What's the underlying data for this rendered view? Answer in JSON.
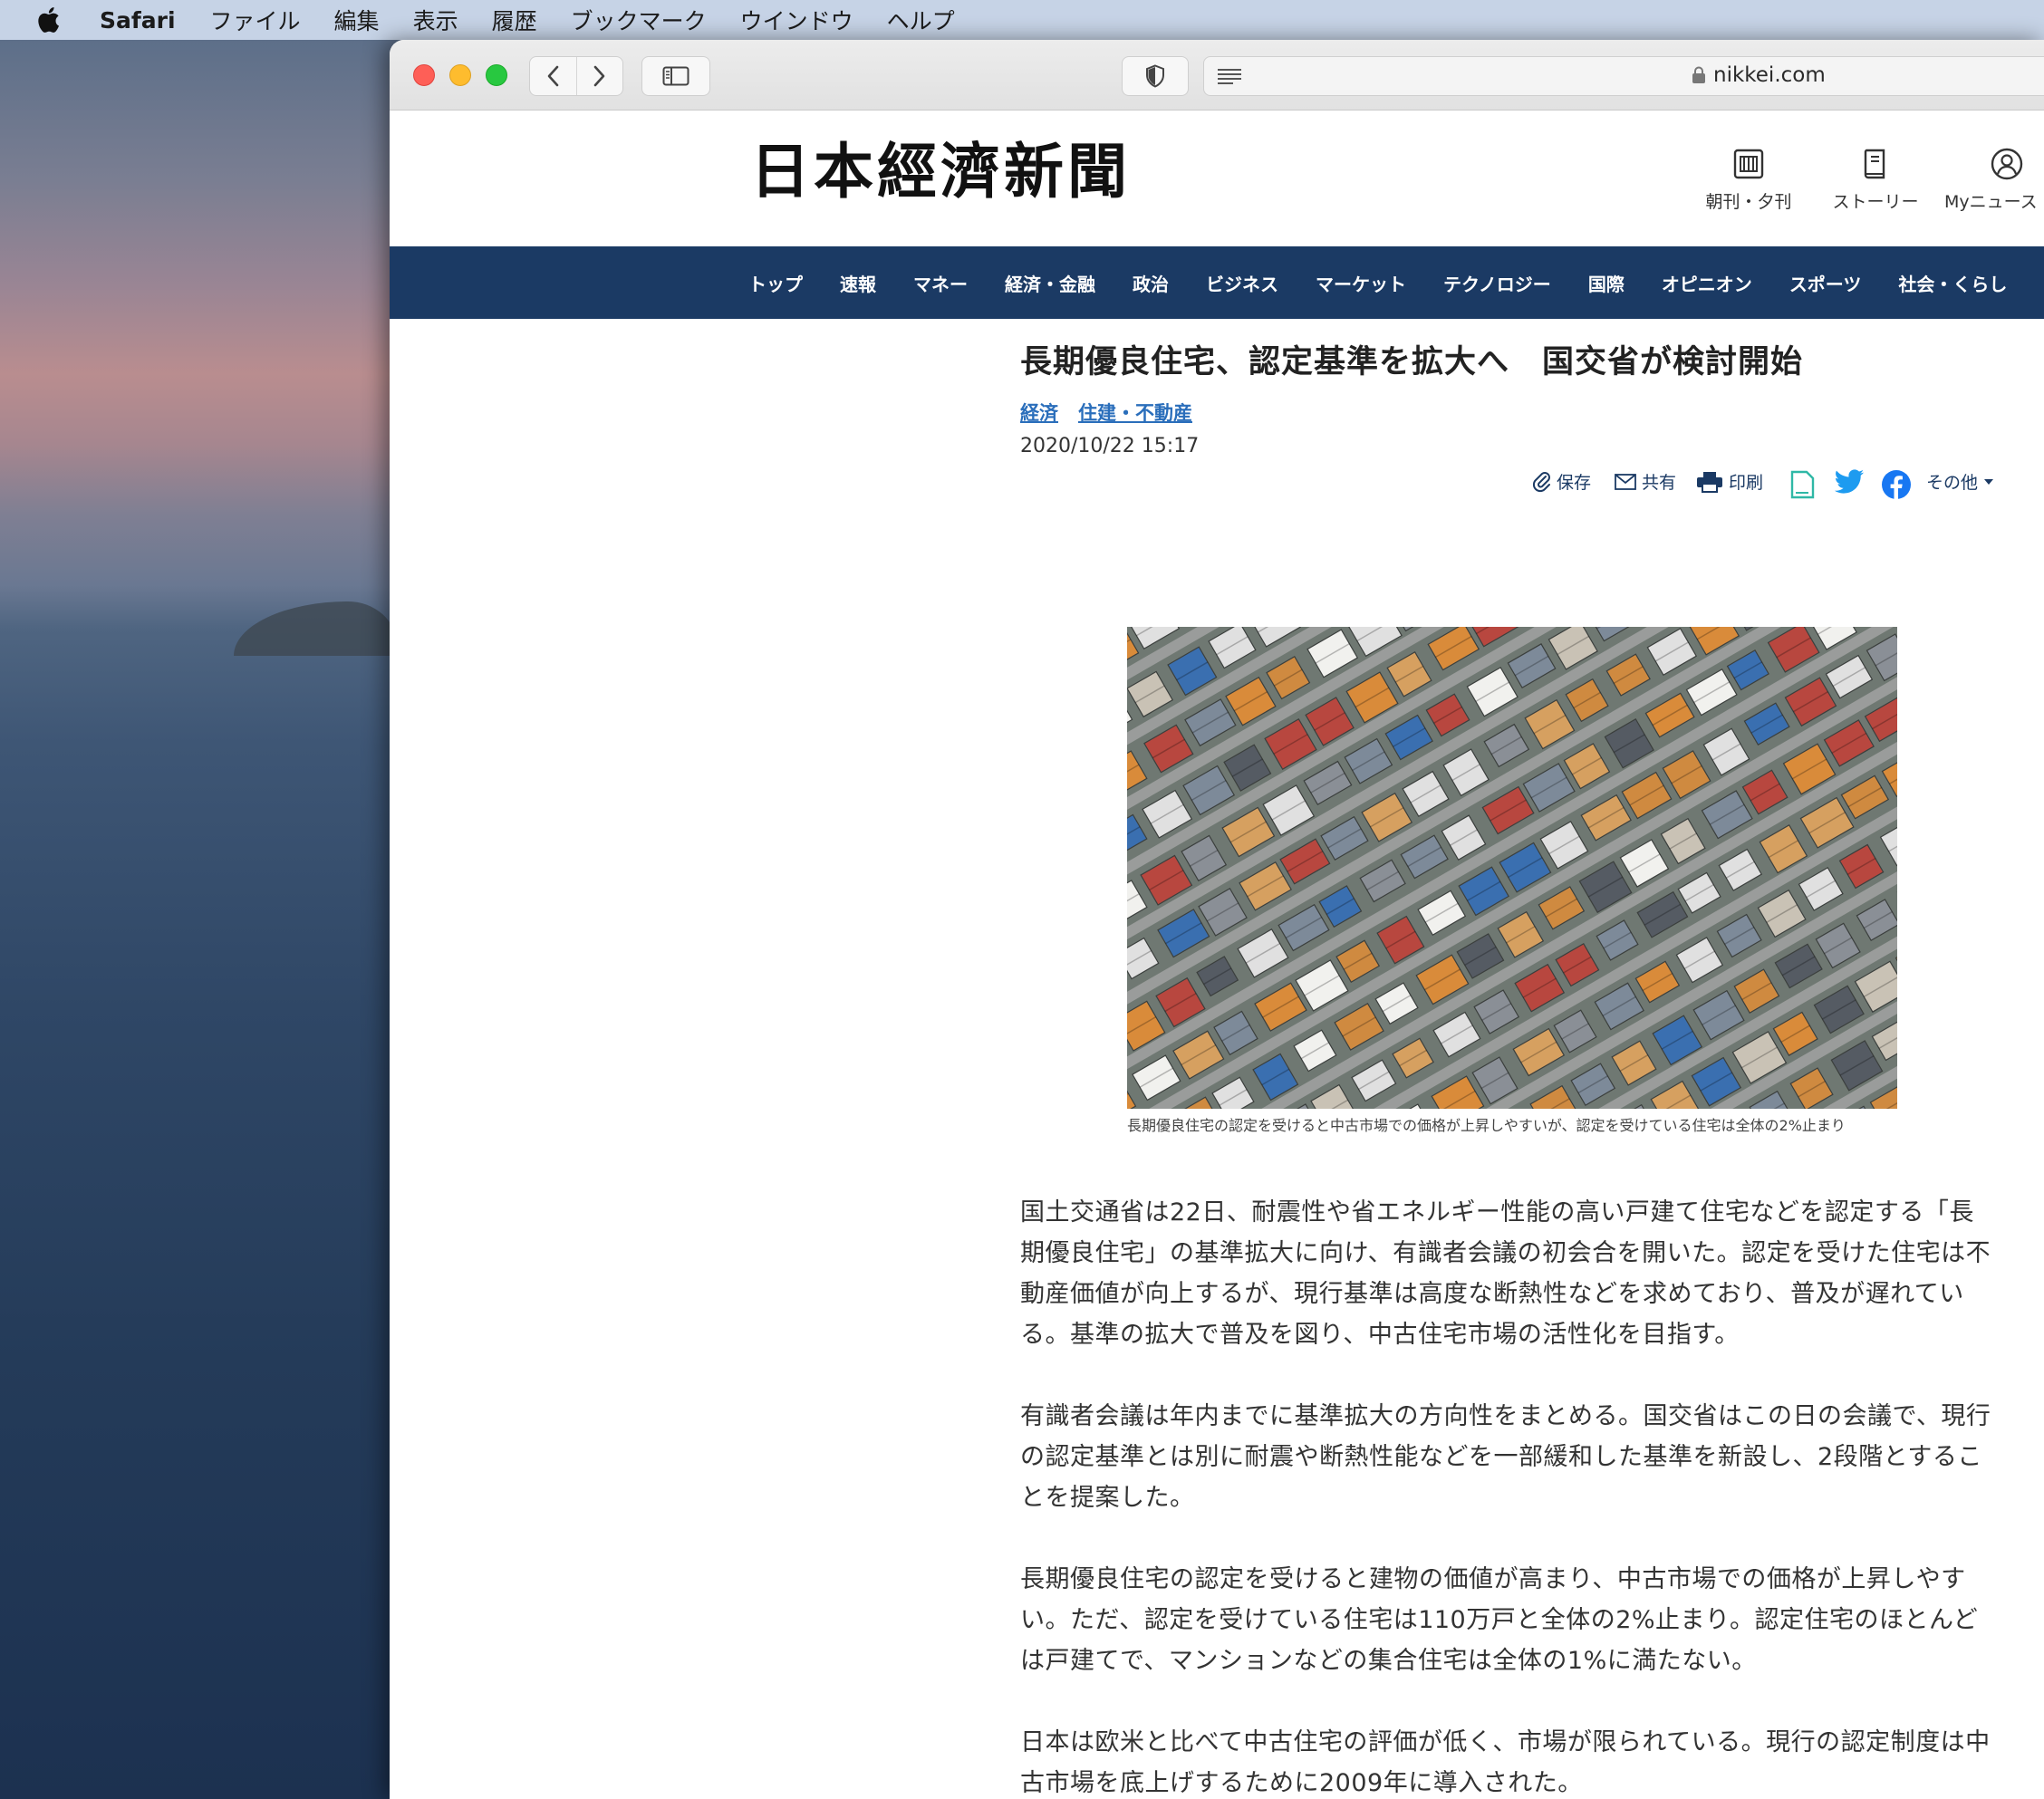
{
  "menubar": {
    "app": "Safari",
    "items": [
      "ファイル",
      "編集",
      "表示",
      "履歴",
      "ブックマーク",
      "ウインドウ",
      "ヘルプ"
    ]
  },
  "browser": {
    "url": "nikkei.com"
  },
  "site": {
    "logo": "日本經濟新聞",
    "header_icons": {
      "paper": "朝刊・夕刊",
      "story": "ストーリー",
      "mynews": "Myニュース"
    },
    "nav": [
      "トップ",
      "速報",
      "マネー",
      "経済・金融",
      "政治",
      "ビジネス",
      "マーケット",
      "テクノロジー",
      "国際",
      "オピニオン",
      "スポーツ",
      "社会・くらし"
    ]
  },
  "article": {
    "headline": "長期優良住宅、認定基準を拡大へ　国交省が検討開始",
    "tags": [
      "経済",
      "住建・不動産"
    ],
    "timestamp": "2020/10/22 15:17",
    "share": {
      "save": "保存",
      "mail": "共有",
      "print": "印刷",
      "more": "その他"
    },
    "caption": "長期優良住宅の認定を受けると中古市場での価格が上昇しやすいが、認定を受けている住宅は全体の2%止まり",
    "paragraphs": [
      "国土交通省は22日、耐震性や省エネルギー性能の高い戸建て住宅などを認定する「長期優良住宅」の基準拡大に向け、有識者会議の初会合を開いた。認定を受けた住宅は不動産価値が向上するが、現行基準は高度な断熱性などを求めており、普及が遅れている。基準の拡大で普及を図り、中古住宅市場の活性化を目指す。",
      "有識者会議は年内までに基準拡大の方向性をまとめる。国交省はこの日の会議で、現行の認定基準とは別に耐震や断熱性能などを一部緩和した基準を新設し、2段階とすることを提案した。",
      "長期優良住宅の認定を受けると建物の価値が高まり、中古市場での価格が上昇しやすい。ただ、認定を受けている住宅は110万戸と全体の2%止まり。認定住宅のほとんどは戸建てで、マンションなどの集合住宅は全体の1%に満たない。",
      "日本は欧米と比べて中古住宅の評価が低く、市場が限られている。現行の認定制度は中古市場を底上げするために2009年に導入された。"
    ]
  }
}
